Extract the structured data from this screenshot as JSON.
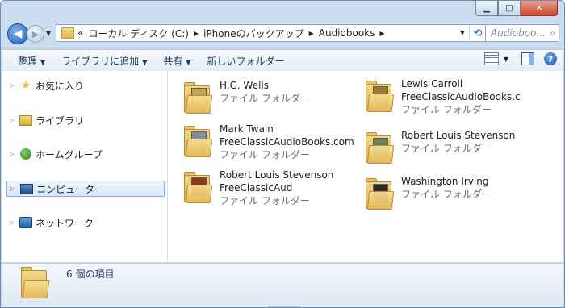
{
  "breadcrumb": {
    "overflow": "«",
    "items": [
      "ローカル ディスク (C:)",
      "iPhoneのバックアップ",
      "Audiobooks"
    ]
  },
  "search": {
    "placeholder": "Audioboo..."
  },
  "toolbar": {
    "organize": "整理",
    "add_to_library": "ライブラリに追加",
    "share": "共有",
    "new_folder": "新しいフォルダー"
  },
  "sidebar": {
    "items": [
      {
        "label": "お気に入り",
        "icon": "star-icon"
      },
      {
        "label": "ライブラリ",
        "icon": "library-icon"
      },
      {
        "label": "ホームグループ",
        "icon": "homegroup-icon"
      },
      {
        "label": "コンピューター",
        "icon": "computer-icon",
        "selected": true
      },
      {
        "label": "ネットワーク",
        "icon": "network-icon"
      }
    ]
  },
  "folders": [
    {
      "name_lines": [
        "H.G. Wells"
      ],
      "type": "ファイル フォルダー",
      "cover_color": "#c8a45a"
    },
    {
      "name_lines": [
        "Lewis Carroll",
        "FreeClassicAudioBooks.c"
      ],
      "type": "ファイル フォルダー",
      "cover_color": "#9c7a3a"
    },
    {
      "name_lines": [
        "Mark Twain",
        "FreeClassicAudioBooks.com"
      ],
      "type": "ファイル フォルダー",
      "cover_color": "#7a8fa8"
    },
    {
      "name_lines": [
        "Robert Louis Stevenson"
      ],
      "type": "ファイル フォルダー",
      "cover_color": "#6f7f5a"
    },
    {
      "name_lines": [
        "Robert Louis Stevenson",
        "FreeClassicAud"
      ],
      "type": "ファイル フォルダー",
      "cover_color": "#8a3a22"
    },
    {
      "name_lines": [
        "Washington Irving"
      ],
      "type": "ファイル フォルダー",
      "cover_color": "#2b2b2b"
    }
  ],
  "status": {
    "item_count": "6 個の項目"
  }
}
